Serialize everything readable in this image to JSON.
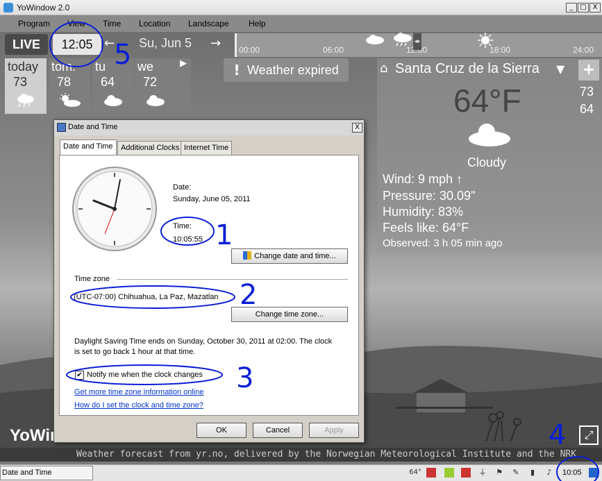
{
  "app": {
    "title": "YoWindow 2.0",
    "logo": "YoWin",
    "minimize": "_",
    "maximize": "□",
    "close": "X"
  },
  "menu": [
    "Program",
    "View",
    "Time",
    "Location",
    "Landscape",
    "Help"
  ],
  "time_controls": {
    "live": "LIVE",
    "time": "12:05",
    "date": "Su, Jun 5"
  },
  "timeline": {
    "ticks": [
      "00:00",
      "06:00",
      "12:00",
      "18:00",
      "24:00"
    ],
    "cursor": "◂▸"
  },
  "days": [
    {
      "name": "today",
      "temp": "73",
      "icon": "cloud-rain-icon"
    },
    {
      "name": "tom.",
      "temp": "78",
      "icon": "sun-cloud-icon"
    },
    {
      "name": "tu",
      "temp": "64",
      "icon": "cloud-icon"
    },
    {
      "name": "we",
      "temp": "72",
      "icon": "cloud-icon"
    }
  ],
  "days_next": "▶",
  "weather_expired": {
    "icon": "!",
    "text": "Weather expired"
  },
  "location": {
    "pin": "⌂",
    "name": "Santa Cruz de la Sierra",
    "dropdown": "▼",
    "add": "+"
  },
  "current": {
    "temp": "64°F",
    "high": "73",
    "low": "64",
    "condition": "Cloudy",
    "wind": "Wind:  9 mph  ↑",
    "pressure": "Pressure:  30.09\"",
    "humidity": "Humidity:  83%",
    "feels_like": "Feels like:  64°F",
    "observed": "Observed:  3 h 05 min ago"
  },
  "fullscreen": "⤢",
  "credit": "Weather forecast from  yr.no, delivered by the Norwegian Meteorological Institute and the NRK",
  "taskbar": {
    "task": "Date and Time",
    "clock": "10:05",
    "tray_temp": "64°"
  },
  "dialog": {
    "title": "Date and Time",
    "close": "X",
    "tabs": [
      "Date and Time",
      "Additional Clocks",
      "Internet Time"
    ],
    "date_label": "Date:",
    "date_value": "Sunday, June 05, 2011",
    "time_label": "Time:",
    "time_value": "10:05:55",
    "change_date_btn": "Change date and time...",
    "timezone_header": "Time zone",
    "timezone_value": "(UTC-07:00) Chihuahua, La Paz, Mazatlan",
    "change_tz_btn": "Change time zone...",
    "dst_line1": "Daylight Saving Time ends on Sunday, October 30, 2011 at 02:00. The clock",
    "dst_line2": "is set to go back 1 hour at that time.",
    "notify_label": "Notify me when the clock changes",
    "notify_checked": "✔",
    "link1": "Get more time zone information online",
    "link2": "How do I set the clock and time zone?",
    "ok": "OK",
    "cancel": "Cancel",
    "apply": "Apply"
  },
  "annotation_labels": [
    "1",
    "2",
    "3",
    "4",
    "5"
  ],
  "colors": {
    "annotation": "#0a1fd6",
    "link": "#0033cc",
    "panel": "#969696"
  }
}
